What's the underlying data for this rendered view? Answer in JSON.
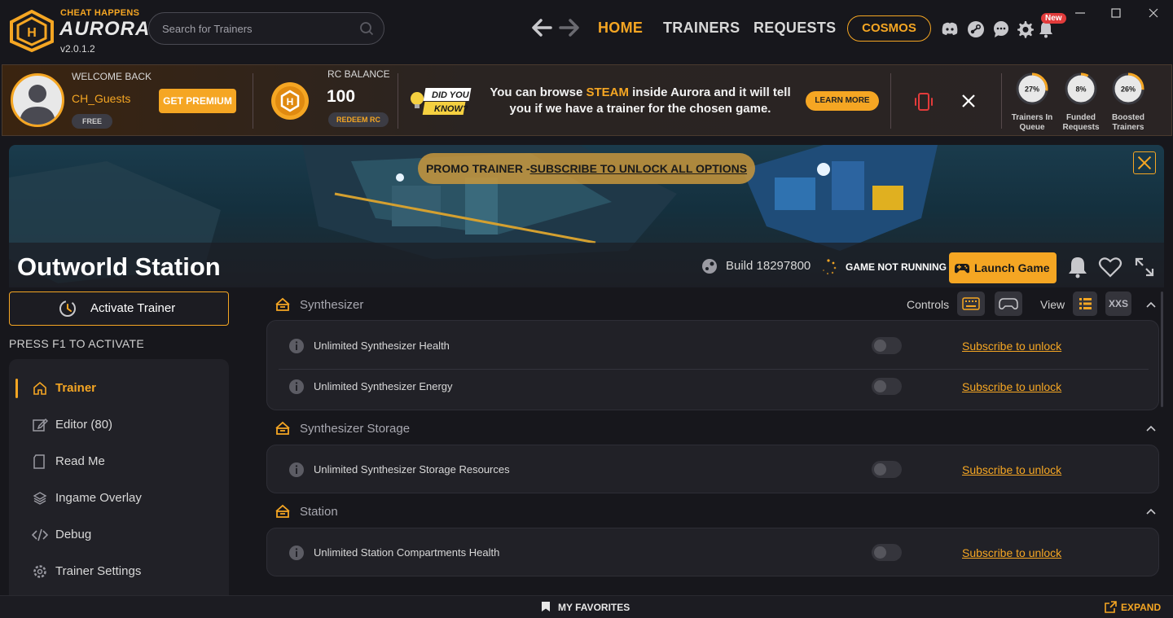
{
  "brand": {
    "top": "CHEAT HAPPENS",
    "name": "AURORA",
    "version": "v2.0.1.2"
  },
  "search": {
    "placeholder": "Search for Trainers"
  },
  "nav": {
    "home": "HOME",
    "trainers": "TRAINERS",
    "requests": "REQUESTS",
    "cosmos": "COSMOS",
    "new_badge": "New"
  },
  "user": {
    "welcome": "WELCOME BACK",
    "name": "CH_Guests",
    "tier": "FREE",
    "premium_btn": "GET PREMIUM"
  },
  "rc": {
    "label": "RC BALANCE",
    "value": "100",
    "redeem": "REDEEM RC"
  },
  "tip": {
    "badge_line1": "DID YOU",
    "badge_line2": "KNOW?",
    "text_pre": "You can browse ",
    "text_highlight": "STEAM",
    "text_post": " inside Aurora and it will tell you if we have a trainer for the chosen game.",
    "learn_more": "LEARN MORE"
  },
  "stats": [
    {
      "value": "27%",
      "label_1": "Trainers In",
      "label_2": "Queue",
      "fraction": 0.27
    },
    {
      "value": "8%",
      "label_1": "Funded",
      "label_2": "Requests",
      "fraction": 0.08
    },
    {
      "value": "26%",
      "label_1": "Boosted",
      "label_2": "Trainers",
      "fraction": 0.26
    }
  ],
  "hero": {
    "promo_pre": "PROMO TRAINER -",
    "promo_link": "SUBSCRIBE TO UNLOCK ALL OPTIONS",
    "title": "Outworld Station",
    "build": "Build 18297800",
    "status": "GAME NOT RUNNING",
    "launch": "Launch Game"
  },
  "sidebar": {
    "activate": "Activate Trainer",
    "press": "PRESS F1 TO ACTIVATE",
    "items": [
      {
        "label": "Trainer",
        "icon": "home-icon",
        "active": true
      },
      {
        "label": "Editor (80)",
        "icon": "edit-icon"
      },
      {
        "label": "Read Me",
        "icon": "document-icon"
      },
      {
        "label": "Ingame Overlay",
        "icon": "layers-icon"
      },
      {
        "label": "Debug",
        "icon": "code-icon"
      },
      {
        "label": "Trainer Settings",
        "icon": "gear-icon"
      }
    ]
  },
  "controls": {
    "label": "Controls",
    "view": "View",
    "xxs": "XXS"
  },
  "sections": [
    {
      "title": "Synthesizer",
      "options": [
        "Unlimited Synthesizer Health",
        "Unlimited Synthesizer Energy"
      ]
    },
    {
      "title": "Synthesizer Storage",
      "options": [
        "Unlimited Synthesizer Storage Resources"
      ]
    },
    {
      "title": "Station",
      "options": [
        "Unlimited Station Compartments Health"
      ]
    }
  ],
  "subscribe_text": "Subscribe to unlock",
  "bottom": {
    "favorites": "MY FAVORITES",
    "expand": "EXPAND"
  },
  "colors": {
    "accent": "#f5a623",
    "bg": "#17171c",
    "panel": "#212127"
  }
}
